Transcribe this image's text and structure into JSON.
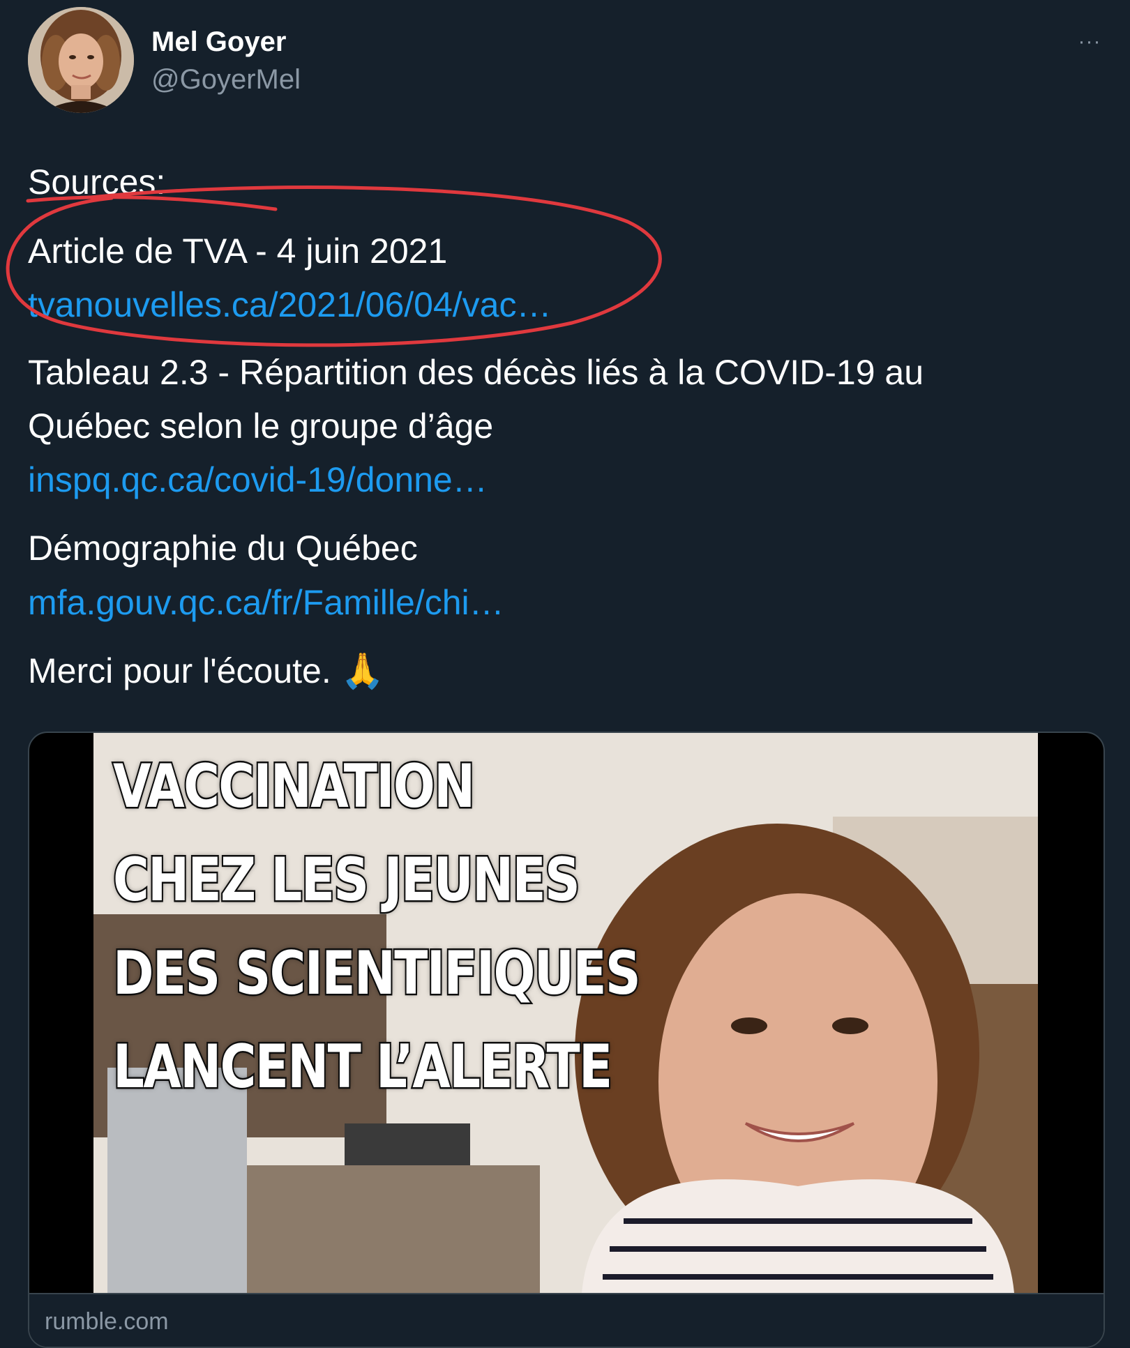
{
  "author": {
    "display_name": "Mel Goyer",
    "handle": "@GoyerMel"
  },
  "menu": {
    "more_icon": "more-horizontal-icon",
    "more_glyph": "···"
  },
  "tweet": {
    "sources_label": "Sources:",
    "article_line": "Article de TVA - 4 juin 2021",
    "link_tva": "tvanouvelles.ca/2021/06/04/vac…",
    "tableau_line1": "Tableau 2.3 - Répartition des décès liés à la COVID-19 au",
    "tableau_line2": "Québec selon le groupe d’âge",
    "link_inspq": "inspq.qc.ca/covid-19/donne…",
    "demographie": "Démographie du Québec",
    "link_mfa": "mfa.gouv.qc.ca/fr/Famille/chi…",
    "merci": "Merci pour l'écoute.",
    "emoji": "🙏"
  },
  "annotation": {
    "color": "#e0393e"
  },
  "media": {
    "headline": [
      "VACCINATION",
      "CHEZ LES JEUNES",
      "DES SCIENTIFIQUES",
      "LANCENT L’ALERTE"
    ],
    "domain": "rumble.com"
  },
  "colors": {
    "background": "#15202b",
    "link": "#1d9bf0",
    "secondary_text": "#8b98a5",
    "border": "#38444d"
  }
}
